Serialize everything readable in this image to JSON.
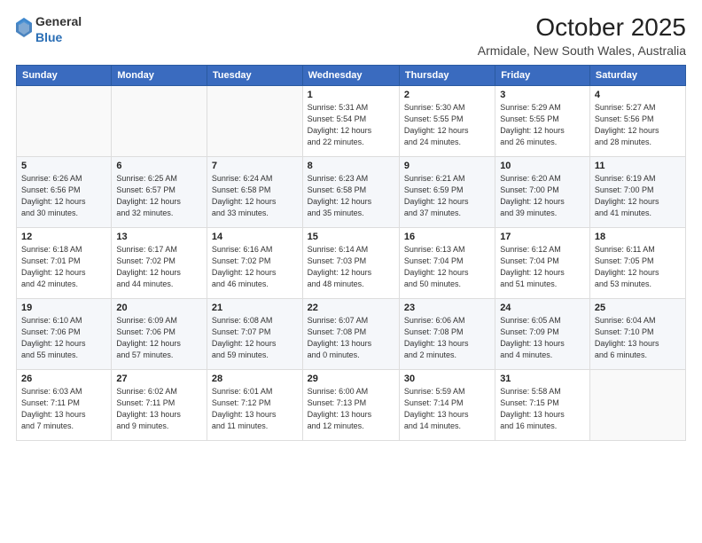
{
  "logo": {
    "general": "General",
    "blue": "Blue"
  },
  "header": {
    "month": "October 2025",
    "location": "Armidale, New South Wales, Australia"
  },
  "weekdays": [
    "Sunday",
    "Monday",
    "Tuesday",
    "Wednesday",
    "Thursday",
    "Friday",
    "Saturday"
  ],
  "weeks": [
    [
      {
        "day": "",
        "info": ""
      },
      {
        "day": "",
        "info": ""
      },
      {
        "day": "",
        "info": ""
      },
      {
        "day": "1",
        "info": "Sunrise: 5:31 AM\nSunset: 5:54 PM\nDaylight: 12 hours\nand 22 minutes."
      },
      {
        "day": "2",
        "info": "Sunrise: 5:30 AM\nSunset: 5:55 PM\nDaylight: 12 hours\nand 24 minutes."
      },
      {
        "day": "3",
        "info": "Sunrise: 5:29 AM\nSunset: 5:55 PM\nDaylight: 12 hours\nand 26 minutes."
      },
      {
        "day": "4",
        "info": "Sunrise: 5:27 AM\nSunset: 5:56 PM\nDaylight: 12 hours\nand 28 minutes."
      }
    ],
    [
      {
        "day": "5",
        "info": "Sunrise: 6:26 AM\nSunset: 6:56 PM\nDaylight: 12 hours\nand 30 minutes."
      },
      {
        "day": "6",
        "info": "Sunrise: 6:25 AM\nSunset: 6:57 PM\nDaylight: 12 hours\nand 32 minutes."
      },
      {
        "day": "7",
        "info": "Sunrise: 6:24 AM\nSunset: 6:58 PM\nDaylight: 12 hours\nand 33 minutes."
      },
      {
        "day": "8",
        "info": "Sunrise: 6:23 AM\nSunset: 6:58 PM\nDaylight: 12 hours\nand 35 minutes."
      },
      {
        "day": "9",
        "info": "Sunrise: 6:21 AM\nSunset: 6:59 PM\nDaylight: 12 hours\nand 37 minutes."
      },
      {
        "day": "10",
        "info": "Sunrise: 6:20 AM\nSunset: 7:00 PM\nDaylight: 12 hours\nand 39 minutes."
      },
      {
        "day": "11",
        "info": "Sunrise: 6:19 AM\nSunset: 7:00 PM\nDaylight: 12 hours\nand 41 minutes."
      }
    ],
    [
      {
        "day": "12",
        "info": "Sunrise: 6:18 AM\nSunset: 7:01 PM\nDaylight: 12 hours\nand 42 minutes."
      },
      {
        "day": "13",
        "info": "Sunrise: 6:17 AM\nSunset: 7:02 PM\nDaylight: 12 hours\nand 44 minutes."
      },
      {
        "day": "14",
        "info": "Sunrise: 6:16 AM\nSunset: 7:02 PM\nDaylight: 12 hours\nand 46 minutes."
      },
      {
        "day": "15",
        "info": "Sunrise: 6:14 AM\nSunset: 7:03 PM\nDaylight: 12 hours\nand 48 minutes."
      },
      {
        "day": "16",
        "info": "Sunrise: 6:13 AM\nSunset: 7:04 PM\nDaylight: 12 hours\nand 50 minutes."
      },
      {
        "day": "17",
        "info": "Sunrise: 6:12 AM\nSunset: 7:04 PM\nDaylight: 12 hours\nand 51 minutes."
      },
      {
        "day": "18",
        "info": "Sunrise: 6:11 AM\nSunset: 7:05 PM\nDaylight: 12 hours\nand 53 minutes."
      }
    ],
    [
      {
        "day": "19",
        "info": "Sunrise: 6:10 AM\nSunset: 7:06 PM\nDaylight: 12 hours\nand 55 minutes."
      },
      {
        "day": "20",
        "info": "Sunrise: 6:09 AM\nSunset: 7:06 PM\nDaylight: 12 hours\nand 57 minutes."
      },
      {
        "day": "21",
        "info": "Sunrise: 6:08 AM\nSunset: 7:07 PM\nDaylight: 12 hours\nand 59 minutes."
      },
      {
        "day": "22",
        "info": "Sunrise: 6:07 AM\nSunset: 7:08 PM\nDaylight: 13 hours\nand 0 minutes."
      },
      {
        "day": "23",
        "info": "Sunrise: 6:06 AM\nSunset: 7:08 PM\nDaylight: 13 hours\nand 2 minutes."
      },
      {
        "day": "24",
        "info": "Sunrise: 6:05 AM\nSunset: 7:09 PM\nDaylight: 13 hours\nand 4 minutes."
      },
      {
        "day": "25",
        "info": "Sunrise: 6:04 AM\nSunset: 7:10 PM\nDaylight: 13 hours\nand 6 minutes."
      }
    ],
    [
      {
        "day": "26",
        "info": "Sunrise: 6:03 AM\nSunset: 7:11 PM\nDaylight: 13 hours\nand 7 minutes."
      },
      {
        "day": "27",
        "info": "Sunrise: 6:02 AM\nSunset: 7:11 PM\nDaylight: 13 hours\nand 9 minutes."
      },
      {
        "day": "28",
        "info": "Sunrise: 6:01 AM\nSunset: 7:12 PM\nDaylight: 13 hours\nand 11 minutes."
      },
      {
        "day": "29",
        "info": "Sunrise: 6:00 AM\nSunset: 7:13 PM\nDaylight: 13 hours\nand 12 minutes."
      },
      {
        "day": "30",
        "info": "Sunrise: 5:59 AM\nSunset: 7:14 PM\nDaylight: 13 hours\nand 14 minutes."
      },
      {
        "day": "31",
        "info": "Sunrise: 5:58 AM\nSunset: 7:15 PM\nDaylight: 13 hours\nand 16 minutes."
      },
      {
        "day": "",
        "info": ""
      }
    ]
  ]
}
